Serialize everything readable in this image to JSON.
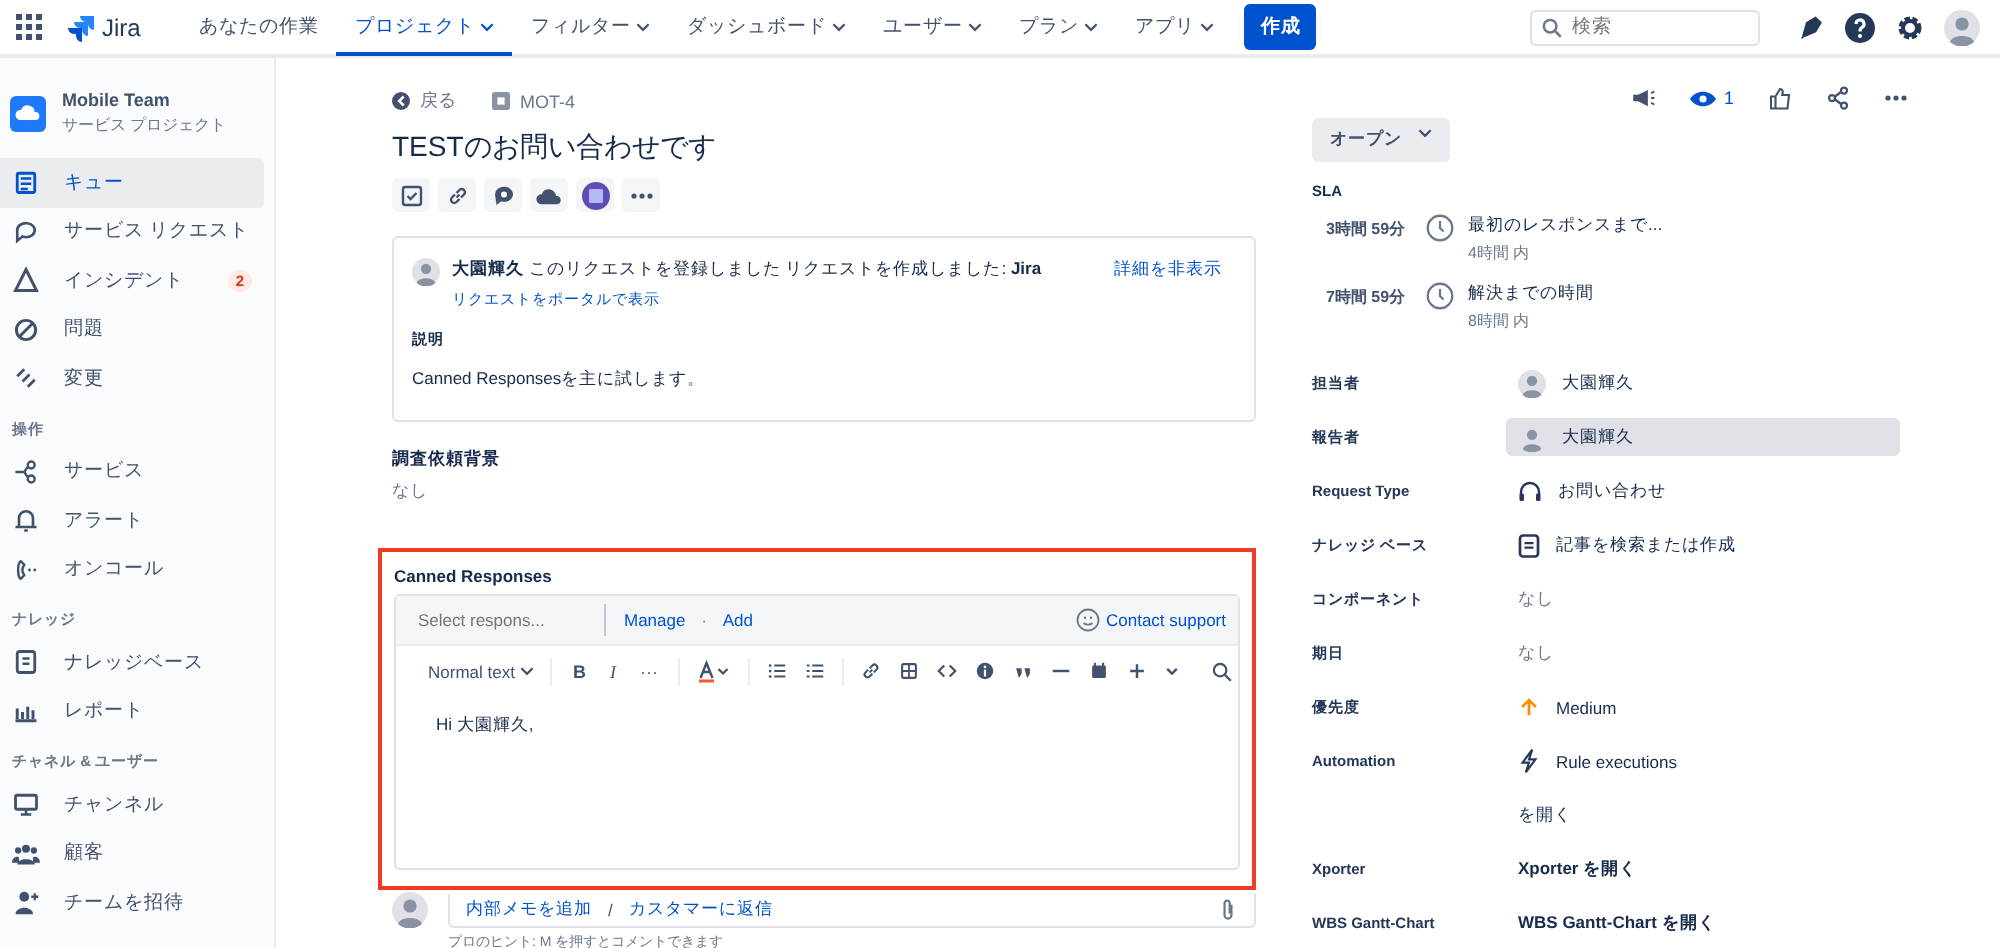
{
  "topnav": {
    "logo": "Jira",
    "items": [
      {
        "label": "あなたの作業",
        "selected": false,
        "dropdown": false
      },
      {
        "label": "プロジェクト",
        "selected": true,
        "dropdown": true
      },
      {
        "label": "フィルター",
        "selected": false,
        "dropdown": true
      },
      {
        "label": "ダッシュボード",
        "selected": false,
        "dropdown": true
      },
      {
        "label": "ユーザー",
        "selected": false,
        "dropdown": true
      },
      {
        "label": "プラン",
        "selected": false,
        "dropdown": true
      },
      {
        "label": "アプリ",
        "selected": false,
        "dropdown": true
      }
    ],
    "create": "作成",
    "search": {
      "placeholder": "検索"
    }
  },
  "sidebar": {
    "project": {
      "name": "Mobile Team",
      "type": "サービス プロジェクト"
    },
    "groups": [
      {
        "items": [
          {
            "label": "キュー",
            "selected": true
          },
          {
            "label": "サービス リクエスト",
            "selected": false
          },
          {
            "label": "インシデント",
            "selected": false,
            "badge": "2"
          },
          {
            "label": "問題",
            "selected": false
          },
          {
            "label": "変更",
            "selected": false
          }
        ]
      },
      {
        "heading": "操作",
        "items": [
          {
            "label": "サービス",
            "selected": false
          },
          {
            "label": "アラート",
            "selected": false
          },
          {
            "label": "オンコール",
            "selected": false
          }
        ]
      },
      {
        "heading": "ナレッジ",
        "items": [
          {
            "label": "ナレッジベース",
            "selected": false
          },
          {
            "label": "レポート",
            "selected": false
          }
        ]
      },
      {
        "heading": "チャネル & ユーザー",
        "items": [
          {
            "label": "チャンネル",
            "selected": false
          },
          {
            "label": "顧客",
            "selected": false
          },
          {
            "label": "チームを招待",
            "selected": false
          }
        ]
      }
    ]
  },
  "issue": {
    "back": "戻る",
    "key": "MOT-4",
    "title": "TESTのお問い合わせです",
    "watch_count": "1"
  },
  "request_card": {
    "message": "**大園輝久** このリクエストを登録しました リクエストを作成しました: **Jira**",
    "portal_link": "リクエストをポータルで表示",
    "toggle": "詳細を非表示",
    "description_label": "説明",
    "description": "Canned Responsesを主に試します。"
  },
  "custom_field": {
    "label": "調査依頼背景",
    "value": "なし"
  },
  "canned": {
    "title": "Canned Responses",
    "highlighted": true,
    "select_placeholder": "Select respons...",
    "links": [
      "Manage",
      "Add"
    ],
    "link_separator": "·",
    "support": "Contact support",
    "text_style": "Normal text",
    "format_glyphs": [
      "B",
      "I",
      "···"
    ],
    "body": "Hi 大園輝久,"
  },
  "comment": {
    "internal": "内部メモを追加",
    "separator": "/",
    "reply": "カスタマーに返信",
    "hint": "プロのヒント: M を押すとコメントできます"
  },
  "status": "オープン",
  "sla": {
    "heading": "SLA",
    "items": [
      {
        "remaining": "3時間 59分",
        "goal": "最初のレスポンスまで...",
        "within": "4時間 内"
      },
      {
        "remaining": "7時間 59分",
        "goal": "解決までの時間",
        "within": "8時間 内"
      }
    ]
  },
  "fields": [
    {
      "label": "担当者",
      "kind": "person",
      "value": "大園輝久",
      "highlighted": false
    },
    {
      "label": "報告者",
      "kind": "person",
      "value": "大園輝久",
      "highlighted": true
    },
    {
      "label": "Request Type",
      "kind": "request_type",
      "value": "お問い合わせ",
      "highlighted": false
    },
    {
      "label": "ナレッジ ベース",
      "kind": "knowledge",
      "value": "記事を検索または作成",
      "highlighted": false
    },
    {
      "label": "コンポーネント",
      "kind": "none",
      "value": "なし",
      "highlighted": false
    },
    {
      "label": "期日",
      "kind": "none",
      "value": "なし",
      "highlighted": false
    },
    {
      "label": "優先度",
      "kind": "priority",
      "value": "Medium",
      "highlighted": false
    },
    {
      "label": "Automation",
      "kind": "automation",
      "value": "Rule executions",
      "extra": "を開く",
      "highlighted": false
    },
    {
      "label": "Xporter",
      "kind": "link",
      "value": "Xporter を開く",
      "highlighted": false
    },
    {
      "label": "WBS Gantt-Chart",
      "kind": "link",
      "value": "WBS Gantt-Chart を開く",
      "highlighted": false
    }
  ]
}
